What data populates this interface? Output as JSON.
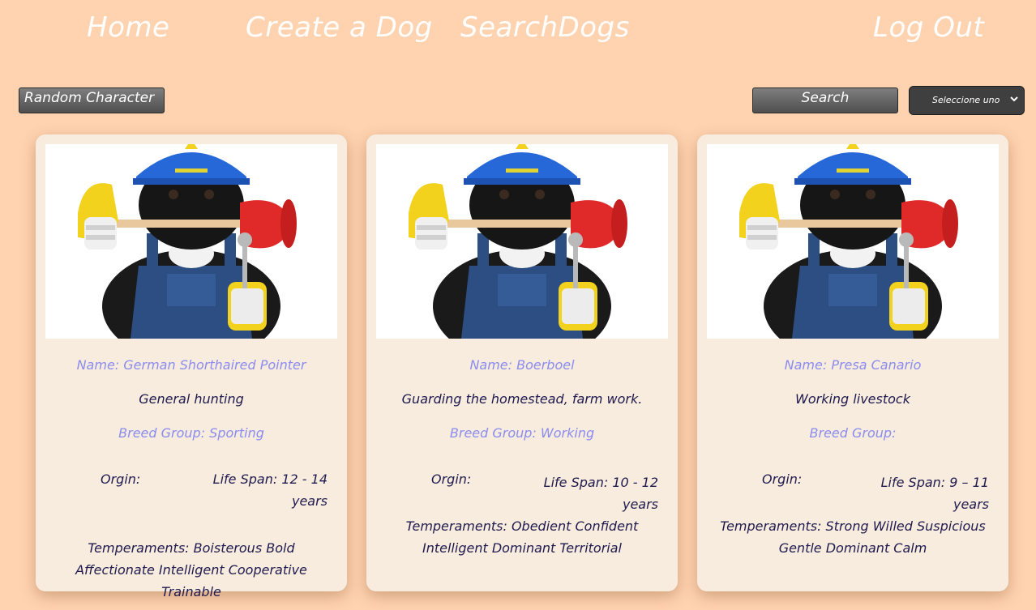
{
  "nav": {
    "home": "Home",
    "create": "Create a Dog",
    "search": "SearchDogs",
    "logout": "Log Out"
  },
  "controls": {
    "random_label": "Random Character",
    "search_label": "Search",
    "select_value": "Seleccione uno"
  },
  "cards": [
    {
      "name": "Name: German Shorthaired Pointer",
      "purpose": "General hunting",
      "breed_group": "Breed Group: Sporting",
      "origin": "Orgin:",
      "life_span": "Life Span: 12 - 14 years",
      "temperaments": "Temperaments: Boisterous Bold Affectionate Intelligent Cooperative Trainable"
    },
    {
      "name": "Name: Boerboel",
      "purpose": "Guarding the homestead, farm work.",
      "breed_group": "Breed Group: Working",
      "origin": "Orgin:",
      "life_span": "Life Span: 10 - 12 years",
      "temperaments": "Temperaments: Obedient Confident Intelligent Dominant Territorial"
    },
    {
      "name": "Name: Presa Canario",
      "purpose": "Working livestock",
      "breed_group": "Breed Group:",
      "origin": "Orgin:",
      "life_span": "Life Span: 9 – 11 years",
      "temperaments": "Temperaments: Strong Willed Suspicious Gentle Dominant Calm"
    }
  ],
  "colors": {
    "background": "#ffd3b0",
    "card": "#f7ecdd",
    "accent_text": "#8a8cf0",
    "body_text": "#1f1a4f"
  }
}
